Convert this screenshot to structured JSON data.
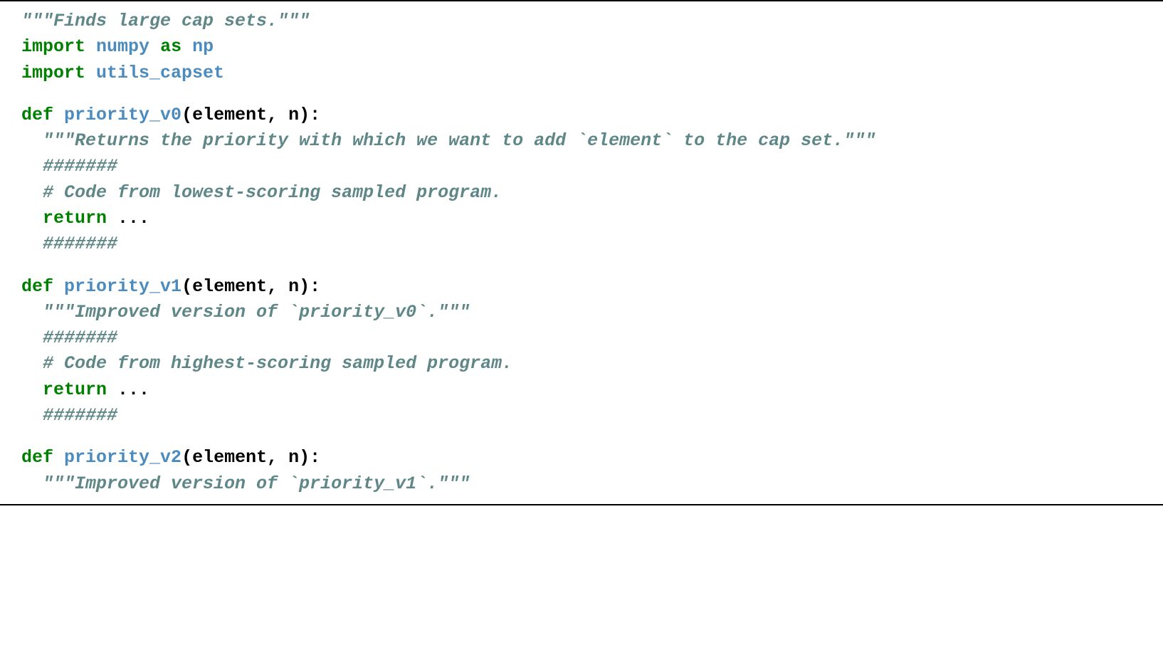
{
  "lines": [
    {
      "type": "doc",
      "text": "\"\"\"Finds large cap sets.\"\"\""
    },
    {
      "type": "import",
      "kw1": "import",
      "mod": "numpy",
      "kw2": "as",
      "alias": "np"
    },
    {
      "type": "import-simple",
      "kw1": "import",
      "mod": "utils_capset"
    },
    {
      "type": "blank"
    },
    {
      "type": "def",
      "kw": "def",
      "fn": "priority_v0",
      "args": "(element, n):"
    },
    {
      "type": "doc-indent",
      "text": "  \"\"\"Returns the priority with which we want to add `element` to the cap set.\"\"\""
    },
    {
      "type": "comment-indent",
      "text": "  #######"
    },
    {
      "type": "comment-indent",
      "text": "  # Code from lowest-scoring sampled program."
    },
    {
      "type": "return-line",
      "indent": "  ",
      "kw": "return",
      "rest": " ..."
    },
    {
      "type": "comment-indent",
      "text": "  #######"
    },
    {
      "type": "blank"
    },
    {
      "type": "def",
      "kw": "def",
      "fn": "priority_v1",
      "args": "(element, n):"
    },
    {
      "type": "doc-indent",
      "text": "  \"\"\"Improved version of `priority_v0`.\"\"\""
    },
    {
      "type": "comment-indent",
      "text": "  #######"
    },
    {
      "type": "comment-indent",
      "text": "  # Code from highest-scoring sampled program."
    },
    {
      "type": "return-line",
      "indent": "  ",
      "kw": "return",
      "rest": " ..."
    },
    {
      "type": "comment-indent",
      "text": "  #######"
    },
    {
      "type": "blank"
    },
    {
      "type": "def",
      "kw": "def",
      "fn": "priority_v2",
      "args": "(element, n):"
    },
    {
      "type": "doc-indent",
      "text": "  \"\"\"Improved version of `priority_v1`.\"\"\""
    }
  ]
}
